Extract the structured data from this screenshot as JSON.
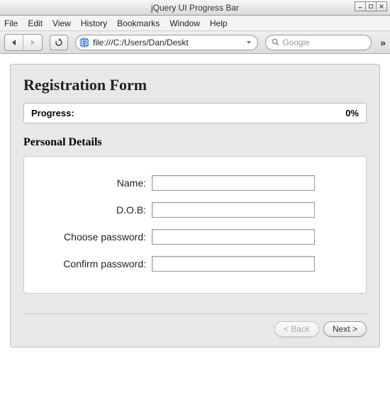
{
  "window": {
    "title": "jQuery UI Progress Bar"
  },
  "menu": {
    "items": [
      "File",
      "Edit",
      "View",
      "History",
      "Bookmarks",
      "Window",
      "Help"
    ]
  },
  "toolbar": {
    "url": "file:///C:/Users/Dan/Deskt",
    "search_placeholder": "Google"
  },
  "page": {
    "heading": "Registration Form",
    "progress": {
      "label": "Progress:",
      "value_text": "0%"
    },
    "section_title": "Personal Details",
    "fields": {
      "name": {
        "label": "Name:",
        "value": ""
      },
      "dob": {
        "label": "D.O.B:",
        "value": ""
      },
      "pw": {
        "label": "Choose password:",
        "value": ""
      },
      "confirm": {
        "label": "Confirm password:",
        "value": ""
      }
    },
    "buttons": {
      "back": "< Back",
      "next": "Next >"
    }
  }
}
